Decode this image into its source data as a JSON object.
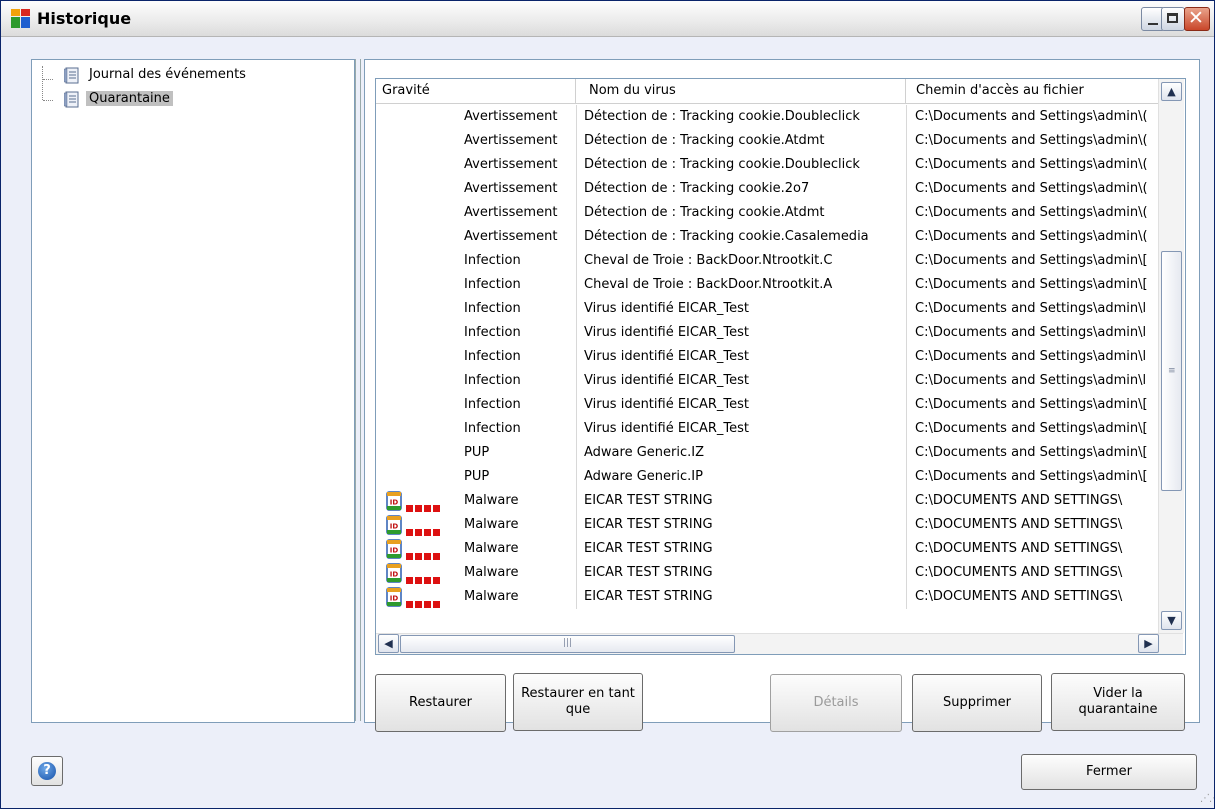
{
  "window": {
    "title": "Historique"
  },
  "tree": {
    "items": [
      {
        "label": "Journal des événements",
        "selected": false,
        "icon": "log-icon"
      },
      {
        "label": "Quarantaine",
        "selected": true,
        "icon": "log-icon"
      }
    ]
  },
  "grid": {
    "columns": [
      "Gravité",
      "Nom du virus",
      "Chemin d'accès au fichier"
    ],
    "rows": [
      {
        "severity": "Avertissement",
        "name": "Détection de : Tracking cookie.Doubleclick",
        "path": "C:\\Documents and Settings\\admin\\(",
        "icon": false
      },
      {
        "severity": "Avertissement",
        "name": "Détection de : Tracking cookie.Atdmt",
        "path": "C:\\Documents and Settings\\admin\\(",
        "icon": false
      },
      {
        "severity": "Avertissement",
        "name": "Détection de : Tracking cookie.Doubleclick",
        "path": "C:\\Documents and Settings\\admin\\(",
        "icon": false
      },
      {
        "severity": "Avertissement",
        "name": "Détection de : Tracking cookie.2o7",
        "path": "C:\\Documents and Settings\\admin\\(",
        "icon": false
      },
      {
        "severity": "Avertissement",
        "name": "Détection de : Tracking cookie.Atdmt",
        "path": "C:\\Documents and Settings\\admin\\(",
        "icon": false
      },
      {
        "severity": "Avertissement",
        "name": "Détection de : Tracking cookie.Casalemedia",
        "path": "C:\\Documents and Settings\\admin\\(",
        "icon": false
      },
      {
        "severity": "Infection",
        "name": "Cheval de Troie : BackDoor.Ntrootkit.C",
        "path": "C:\\Documents and Settings\\admin\\[",
        "icon": false
      },
      {
        "severity": "Infection",
        "name": "Cheval de Troie : BackDoor.Ntrootkit.A",
        "path": "C:\\Documents and Settings\\admin\\[",
        "icon": false
      },
      {
        "severity": "Infection",
        "name": "Virus identifié EICAR_Test",
        "path": "C:\\Documents and Settings\\admin\\l",
        "icon": false
      },
      {
        "severity": "Infection",
        "name": "Virus identifié EICAR_Test",
        "path": "C:\\Documents and Settings\\admin\\l",
        "icon": false
      },
      {
        "severity": "Infection",
        "name": "Virus identifié EICAR_Test",
        "path": "C:\\Documents and Settings\\admin\\l",
        "icon": false
      },
      {
        "severity": "Infection",
        "name": "Virus identifié EICAR_Test",
        "path": "C:\\Documents and Settings\\admin\\l",
        "icon": false
      },
      {
        "severity": "Infection",
        "name": "Virus identifié EICAR_Test",
        "path": "C:\\Documents and Settings\\admin\\[",
        "icon": false
      },
      {
        "severity": "Infection",
        "name": "Virus identifié EICAR_Test",
        "path": "C:\\Documents and Settings\\admin\\[",
        "icon": false
      },
      {
        "severity": "PUP",
        "name": "Adware Generic.IZ",
        "path": "C:\\Documents and Settings\\admin\\[",
        "icon": false
      },
      {
        "severity": "PUP",
        "name": "Adware Generic.IP",
        "path": "C:\\Documents and Settings\\admin\\[",
        "icon": false
      },
      {
        "severity": "Malware",
        "name": "EICAR TEST STRING",
        "path": "C:\\DOCUMENTS AND SETTINGS\\",
        "icon": true
      },
      {
        "severity": "Malware",
        "name": "EICAR TEST STRING",
        "path": "C:\\DOCUMENTS AND SETTINGS\\",
        "icon": true
      },
      {
        "severity": "Malware",
        "name": "EICAR TEST STRING",
        "path": "C:\\DOCUMENTS AND SETTINGS\\",
        "icon": true
      },
      {
        "severity": "Malware",
        "name": "EICAR TEST STRING",
        "path": "C:\\DOCUMENTS AND SETTINGS\\",
        "icon": true
      },
      {
        "severity": "Malware",
        "name": "EICAR TEST STRING",
        "path": "C:\\DOCUMENTS AND SETTINGS\\",
        "icon": true
      }
    ],
    "severity_icon": "identity-shield-icon",
    "severity_bars_color": "#dd1111"
  },
  "buttons": {
    "restore": "Restaurer",
    "restore_as": "Restaurer en tant que",
    "details": "Détails",
    "delete": "Supprimer",
    "empty": "Vider la quarantaine",
    "close": "Fermer"
  },
  "colors": {
    "accent": "#0a246a",
    "client_bg": "#eceff9"
  }
}
